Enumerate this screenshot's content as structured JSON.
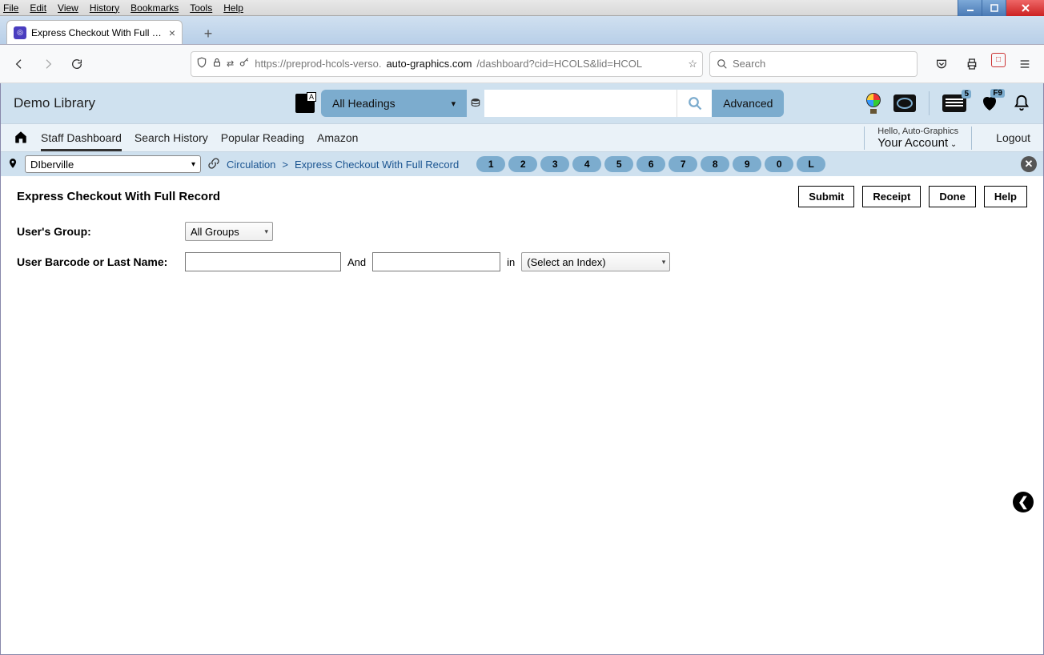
{
  "browser": {
    "menus": [
      "File",
      "Edit",
      "View",
      "History",
      "Bookmarks",
      "Tools",
      "Help"
    ],
    "tab_title": "Express Checkout With Full Rec",
    "url_display_pre": "https://preprod-hcols-verso.",
    "url_display_bold": "auto-graphics.com",
    "url_display_post": "/dashboard?cid=HCOLS&lid=HCOL",
    "search_placeholder": "Search"
  },
  "header": {
    "library_name": "Demo Library",
    "headings_label": "All Headings",
    "advanced_label": "Advanced",
    "card_badge": "5",
    "heart_badge": "F9"
  },
  "nav": {
    "items": [
      "Staff Dashboard",
      "Search History",
      "Popular Reading",
      "Amazon"
    ],
    "hello": "Hello, Auto-Graphics",
    "your_account": "Your Account",
    "logout": "Logout"
  },
  "locrow": {
    "location": "DIberville",
    "crumb1": "Circulation",
    "crumb2": "Express Checkout With Full Record",
    "pills": [
      "1",
      "2",
      "3",
      "4",
      "5",
      "6",
      "7",
      "8",
      "9",
      "0",
      "L"
    ]
  },
  "page": {
    "title": "Express Checkout With Full Record",
    "actions": [
      "Submit",
      "Receipt",
      "Done",
      "Help"
    ]
  },
  "form": {
    "group_label": "User's Group:",
    "group_value": "All Groups",
    "barcode_label": "User Barcode or Last Name:",
    "and": "And",
    "in": "in",
    "index_value": "(Select an Index)"
  }
}
